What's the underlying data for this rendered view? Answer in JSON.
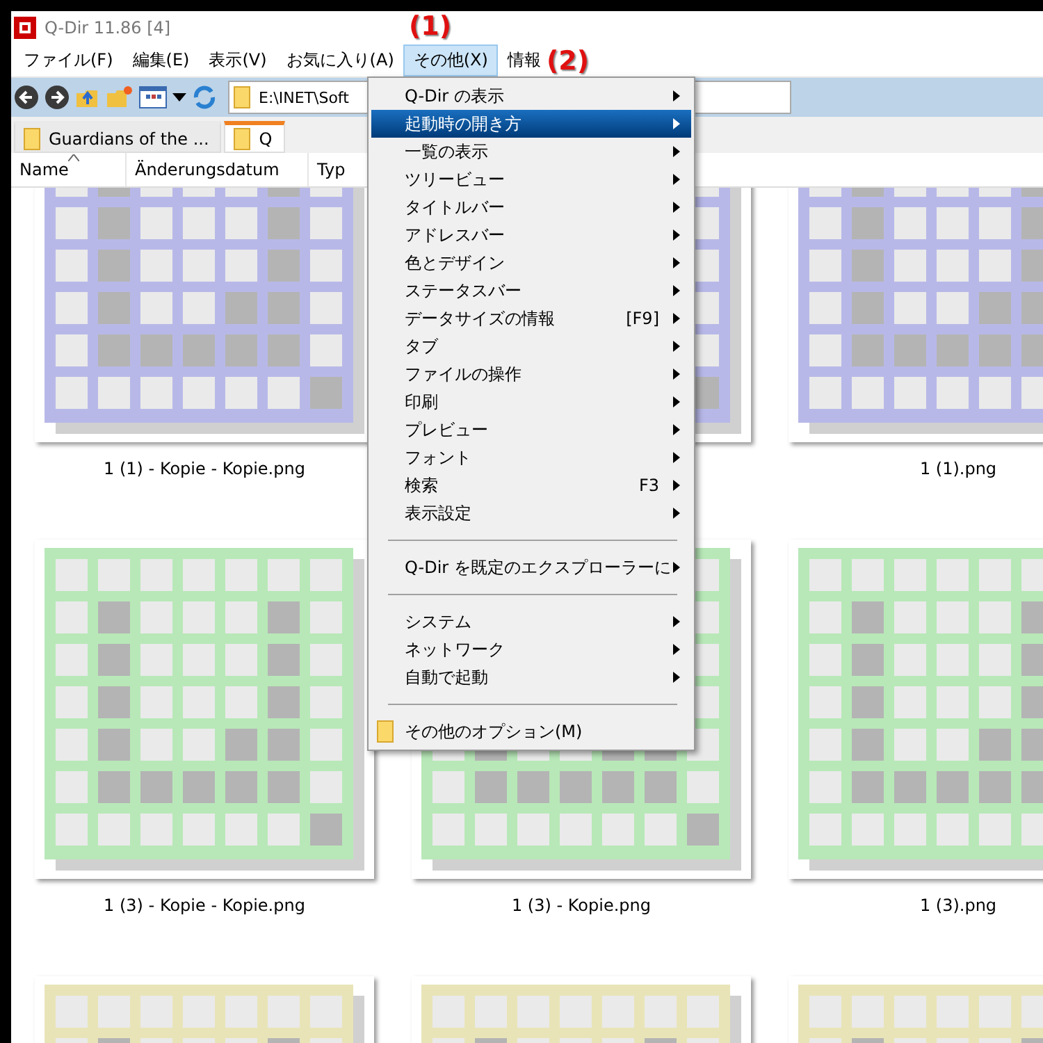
{
  "window": {
    "title": "Q-Dir 11.86 [4]"
  },
  "menu_bar": [
    {
      "label": "ファイル(F)",
      "selected": false
    },
    {
      "label": "編集(E)",
      "selected": false
    },
    {
      "label": "表示(V)",
      "selected": false
    },
    {
      "label": "お気に入り(A)",
      "selected": false
    },
    {
      "label": "その他(X)",
      "selected": true
    },
    {
      "label": "情報",
      "selected": false
    }
  ],
  "address": {
    "value": "E:\\INET\\Soft"
  },
  "tabs": [
    {
      "label": "Guardians of the ...",
      "selected": false
    },
    {
      "label": "Q",
      "selected": true
    }
  ],
  "columns": [
    {
      "label": "Name",
      "sorted": true
    },
    {
      "label": "Änderungsdatum",
      "sorted": false
    },
    {
      "label": "Typ",
      "sorted": false
    }
  ],
  "thumbnails": [
    {
      "name": "1 (1) - Kopie - Kopie.png",
      "color": "#b8b8e8"
    },
    {
      "color": "#b8b8e8"
    },
    {
      "name": "1 (1).png",
      "color": "#b8b8e8"
    },
    {
      "name": "1 (3) - Kopie - Kopie.png",
      "color": "#b8e8b8"
    },
    {
      "name": "1 (3) - Kopie.png",
      "color": "#b8e8b8"
    },
    {
      "name": "1 (3).png",
      "color": "#b8e8b8"
    },
    {
      "color": "#e8e4b8"
    },
    {
      "color": "#e8e4b8"
    },
    {
      "color": "#e8e4b8"
    }
  ],
  "dropdown_menu": [
    {
      "kind": "item",
      "label": "Q-Dir の表示",
      "submenu": true,
      "selected": false
    },
    {
      "kind": "item",
      "label": "起動時の開き方",
      "submenu": true,
      "selected": true
    },
    {
      "kind": "item",
      "label": "一覧の表示",
      "submenu": true,
      "selected": false
    },
    {
      "kind": "item",
      "label": "ツリービュー",
      "submenu": true,
      "selected": false
    },
    {
      "kind": "item",
      "label": "タイトルバー",
      "submenu": true,
      "selected": false
    },
    {
      "kind": "item",
      "label": "アドレスバー",
      "submenu": true,
      "selected": false
    },
    {
      "kind": "item",
      "label": "色とデザイン",
      "submenu": true,
      "selected": false
    },
    {
      "kind": "item",
      "label": "ステータスバー",
      "submenu": true,
      "selected": false
    },
    {
      "kind": "item",
      "label": "データサイズの情報",
      "shortcut": "[F9]",
      "submenu": true,
      "selected": false
    },
    {
      "kind": "item",
      "label": "タブ",
      "submenu": true,
      "selected": false
    },
    {
      "kind": "item",
      "label": "ファイルの操作",
      "submenu": true,
      "selected": false
    },
    {
      "kind": "item",
      "label": "印刷",
      "submenu": true,
      "selected": false
    },
    {
      "kind": "item",
      "label": "プレビュー",
      "submenu": true,
      "selected": false
    },
    {
      "kind": "item",
      "label": "フォント",
      "submenu": true,
      "selected": false
    },
    {
      "kind": "item",
      "label": "検索",
      "shortcut": "F3",
      "submenu": true,
      "selected": false
    },
    {
      "kind": "item",
      "label": "表示設定",
      "submenu": true,
      "selected": false
    },
    {
      "kind": "separator"
    },
    {
      "kind": "item",
      "label": "Q-Dir を既定のエクスプローラーに",
      "submenu": true,
      "selected": false
    },
    {
      "kind": "separator"
    },
    {
      "kind": "item",
      "label": "システム",
      "submenu": true,
      "selected": false
    },
    {
      "kind": "item",
      "label": "ネットワーク",
      "submenu": true,
      "selected": false
    },
    {
      "kind": "item",
      "label": "自動で起動",
      "submenu": true,
      "selected": false
    },
    {
      "kind": "separator"
    },
    {
      "kind": "folder",
      "label": "その他のオプション(M)",
      "submenu": false,
      "selected": false
    }
  ],
  "annotations": [
    "(1)",
    "(2)"
  ]
}
